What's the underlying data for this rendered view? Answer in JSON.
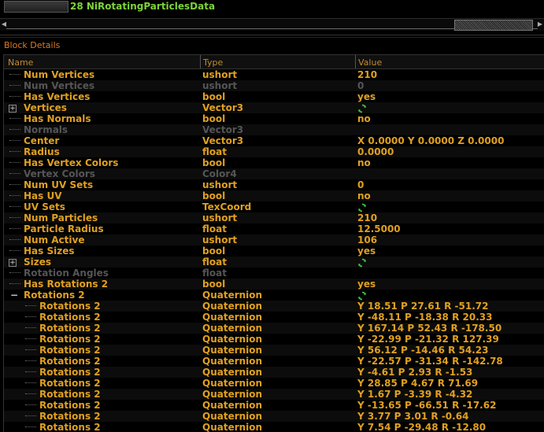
{
  "header": {
    "title": "28 NiRotatingParticlesData"
  },
  "panel": {
    "title": "Block Details"
  },
  "columns": [
    "Name",
    "Type",
    "Value"
  ],
  "rows": [
    {
      "name": "Num Vertices",
      "type": "ushort",
      "value": "210",
      "level": 0,
      "dim": false,
      "expander": "none"
    },
    {
      "name": "Num Vertices",
      "type": "ushort",
      "value": "0",
      "level": 0,
      "dim": true,
      "expander": "none"
    },
    {
      "name": "Has Vertices",
      "type": "bool",
      "value": "yes",
      "level": 0,
      "dim": false,
      "expander": "none"
    },
    {
      "name": "Vertices",
      "type": "Vector3",
      "value": "",
      "level": 0,
      "dim": false,
      "expander": "plus",
      "icon": "refresh-icon"
    },
    {
      "name": "Has Normals",
      "type": "bool",
      "value": "no",
      "level": 0,
      "dim": false,
      "expander": "none"
    },
    {
      "name": "Normals",
      "type": "Vector3",
      "value": "",
      "level": 0,
      "dim": true,
      "expander": "none"
    },
    {
      "name": "Center",
      "type": "Vector3",
      "value": "X 0.0000 Y 0.0000 Z 0.0000",
      "level": 0,
      "dim": false,
      "expander": "none"
    },
    {
      "name": "Radius",
      "type": "float",
      "value": "0.0000",
      "level": 0,
      "dim": false,
      "expander": "none"
    },
    {
      "name": "Has Vertex Colors",
      "type": "bool",
      "value": "no",
      "level": 0,
      "dim": false,
      "expander": "none"
    },
    {
      "name": "Vertex Colors",
      "type": "Color4",
      "value": "",
      "level": 0,
      "dim": true,
      "expander": "none"
    },
    {
      "name": "Num UV Sets",
      "type": "ushort",
      "value": "0",
      "level": 0,
      "dim": false,
      "expander": "none"
    },
    {
      "name": "Has UV",
      "type": "bool",
      "value": "no",
      "level": 0,
      "dim": false,
      "expander": "none"
    },
    {
      "name": "UV Sets",
      "type": "TexCoord",
      "value": "",
      "level": 0,
      "dim": false,
      "expander": "none",
      "icon": "refresh-icon"
    },
    {
      "name": "Num Particles",
      "type": "ushort",
      "value": "210",
      "level": 0,
      "dim": false,
      "expander": "none"
    },
    {
      "name": "Particle Radius",
      "type": "float",
      "value": "12.5000",
      "level": 0,
      "dim": false,
      "expander": "none"
    },
    {
      "name": "Num Active",
      "type": "ushort",
      "value": "106",
      "level": 0,
      "dim": false,
      "expander": "none"
    },
    {
      "name": "Has Sizes",
      "type": "bool",
      "value": "yes",
      "level": 0,
      "dim": false,
      "expander": "none"
    },
    {
      "name": "Sizes",
      "type": "float",
      "value": "",
      "level": 0,
      "dim": false,
      "expander": "plus",
      "icon": "refresh-icon"
    },
    {
      "name": "Rotation Angles",
      "type": "float",
      "value": "",
      "level": 0,
      "dim": true,
      "expander": "none"
    },
    {
      "name": "Has Rotations 2",
      "type": "bool",
      "value": "yes",
      "level": 0,
      "dim": false,
      "expander": "none"
    },
    {
      "name": "Rotations 2",
      "type": "Quaternion",
      "value": "",
      "level": 0,
      "dim": false,
      "expander": "minus",
      "icon": "refresh-icon"
    },
    {
      "name": "Rotations 2",
      "type": "Quaternion",
      "value": "Y 18.51 P 27.61 R -51.72",
      "level": 1,
      "dim": false,
      "expander": "none"
    },
    {
      "name": "Rotations 2",
      "type": "Quaternion",
      "value": "Y -48.11 P -18.38 R 20.33",
      "level": 1,
      "dim": false,
      "expander": "none"
    },
    {
      "name": "Rotations 2",
      "type": "Quaternion",
      "value": "Y 167.14 P 52.43 R -178.50",
      "level": 1,
      "dim": false,
      "expander": "none"
    },
    {
      "name": "Rotations 2",
      "type": "Quaternion",
      "value": "Y -22.99 P -21.32 R 127.39",
      "level": 1,
      "dim": false,
      "expander": "none"
    },
    {
      "name": "Rotations 2",
      "type": "Quaternion",
      "value": "Y 56.12 P -14.46 R 54.23",
      "level": 1,
      "dim": false,
      "expander": "none"
    },
    {
      "name": "Rotations 2",
      "type": "Quaternion",
      "value": "Y -22.57 P -31.34 R -142.78",
      "level": 1,
      "dim": false,
      "expander": "none"
    },
    {
      "name": "Rotations 2",
      "type": "Quaternion",
      "value": "Y -4.61 P 2.93 R -1.53",
      "level": 1,
      "dim": false,
      "expander": "none"
    },
    {
      "name": "Rotations 2",
      "type": "Quaternion",
      "value": "Y 28.85 P 4.67 R 71.69",
      "level": 1,
      "dim": false,
      "expander": "none"
    },
    {
      "name": "Rotations 2",
      "type": "Quaternion",
      "value": "Y 1.67 P -3.39 R -4.32",
      "level": 1,
      "dim": false,
      "expander": "none"
    },
    {
      "name": "Rotations 2",
      "type": "Quaternion",
      "value": "Y -13.65 P -66.51 R -17.62",
      "level": 1,
      "dim": false,
      "expander": "none"
    },
    {
      "name": "Rotations 2",
      "type": "Quaternion",
      "value": "Y 3.77 P 3.01 R -0.64",
      "level": 1,
      "dim": false,
      "expander": "none"
    },
    {
      "name": "Rotations 2",
      "type": "Quaternion",
      "value": "Y 7.54 P -29.48 R -12.80",
      "level": 1,
      "dim": false,
      "expander": "none"
    }
  ],
  "colors": {
    "text": "#e0a020",
    "dim": "#555555",
    "title": "#7dd43a",
    "section": "#e07a20"
  }
}
